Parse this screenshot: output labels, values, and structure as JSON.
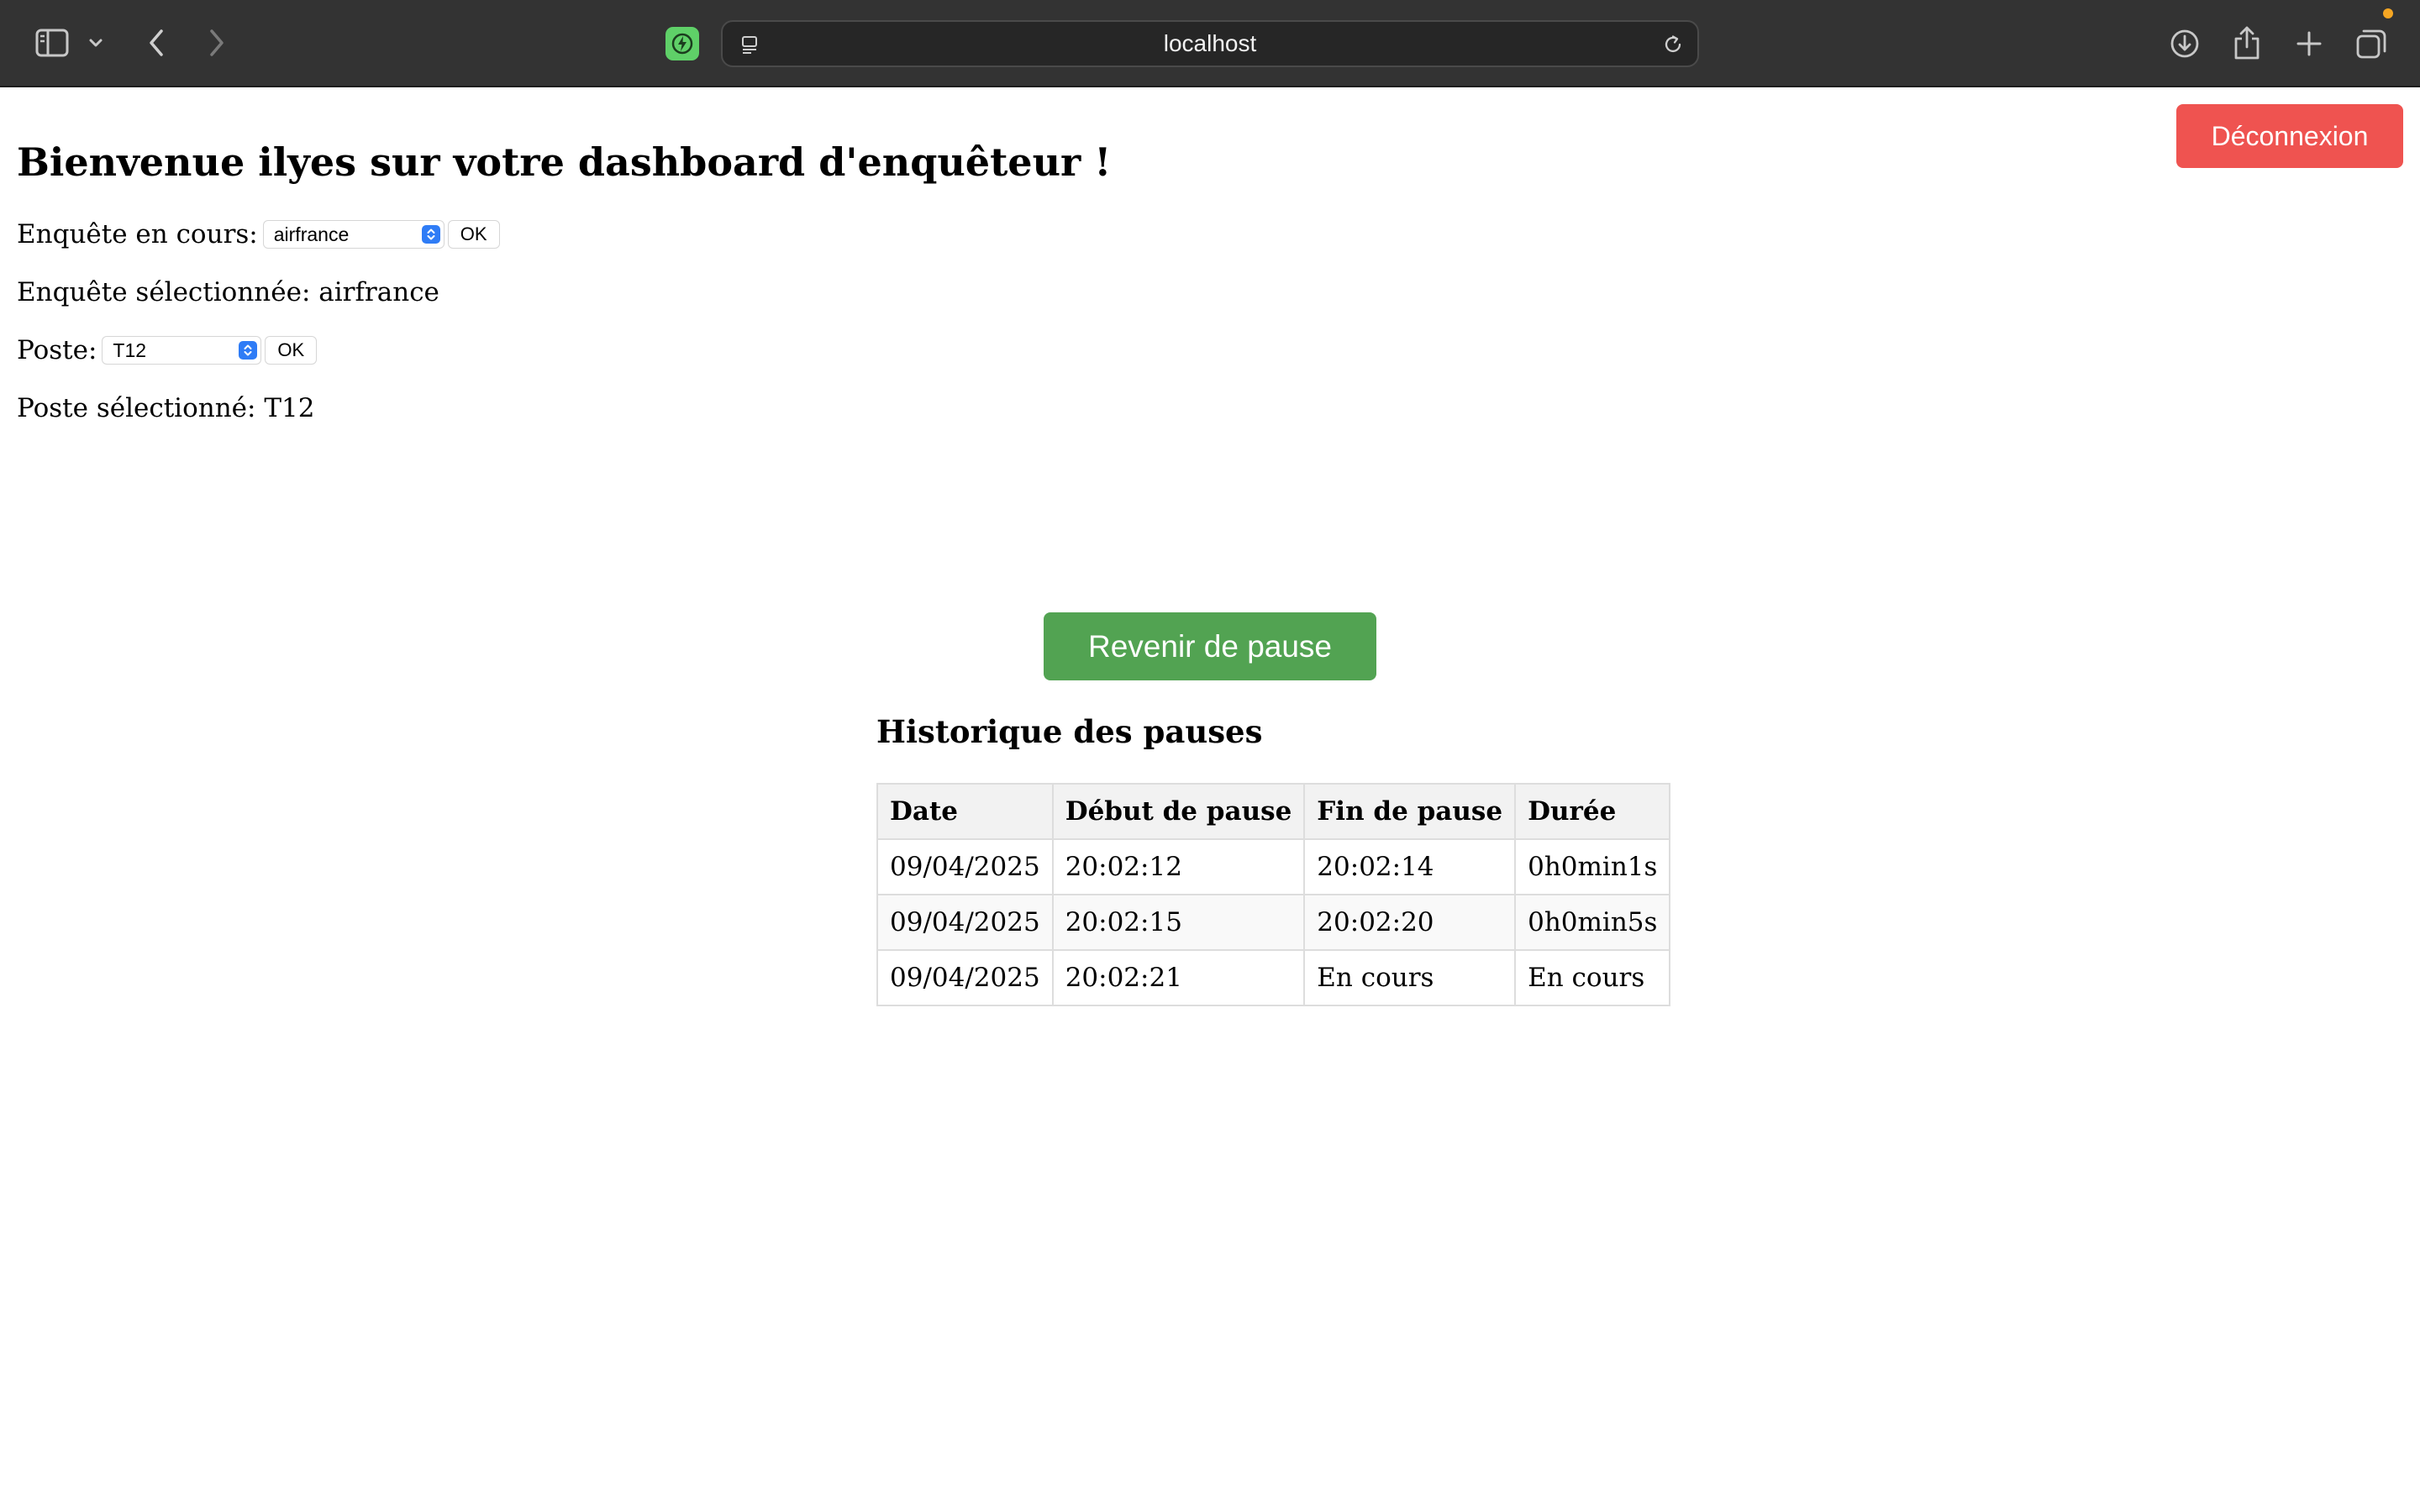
{
  "browser": {
    "url": "localhost",
    "icons": {
      "sidebar": "sidebar-icon",
      "sidebar_menu": "chevron-down-icon",
      "back": "chevron-left-icon",
      "forward": "chevron-right-icon",
      "extension": "lightning-extension-icon",
      "page_settings": "page-settings-icon",
      "reload": "reload-icon",
      "download": "download-icon",
      "share": "share-icon",
      "new_tab": "plus-icon",
      "tab_overview": "tabs-overview-icon"
    }
  },
  "header": {
    "logout_label": "Déconnexion"
  },
  "page": {
    "title": "Bienvenue ilyes sur votre dashboard d'enquêteur !"
  },
  "survey": {
    "label": "Enquête en cours:",
    "selected_value": "airfrance",
    "ok_label": "OK",
    "status_text": "Enquête sélectionnée: airfrance"
  },
  "post": {
    "label": "Poste:",
    "selected_value": "T12",
    "ok_label": "OK",
    "status_text": "Poste sélectionné: T12"
  },
  "pause": {
    "resume_label": "Revenir de pause"
  },
  "history": {
    "title": "Historique des pauses",
    "columns": [
      "Date",
      "Début de pause",
      "Fin de pause",
      "Durée"
    ],
    "rows": [
      [
        "09/04/2025",
        "20:02:12",
        "20:02:14",
        "0h0min1s"
      ],
      [
        "09/04/2025",
        "20:02:15",
        "20:02:20",
        "0h0min5s"
      ],
      [
        "09/04/2025",
        "20:02:21",
        "En cours",
        "En cours"
      ]
    ]
  },
  "colors": {
    "chrome_background": "#333333",
    "logout_button": "#ef5350",
    "resume_button": "#52a352",
    "select_accent": "#2f7cf6",
    "extension_icon": "#5fd068"
  }
}
